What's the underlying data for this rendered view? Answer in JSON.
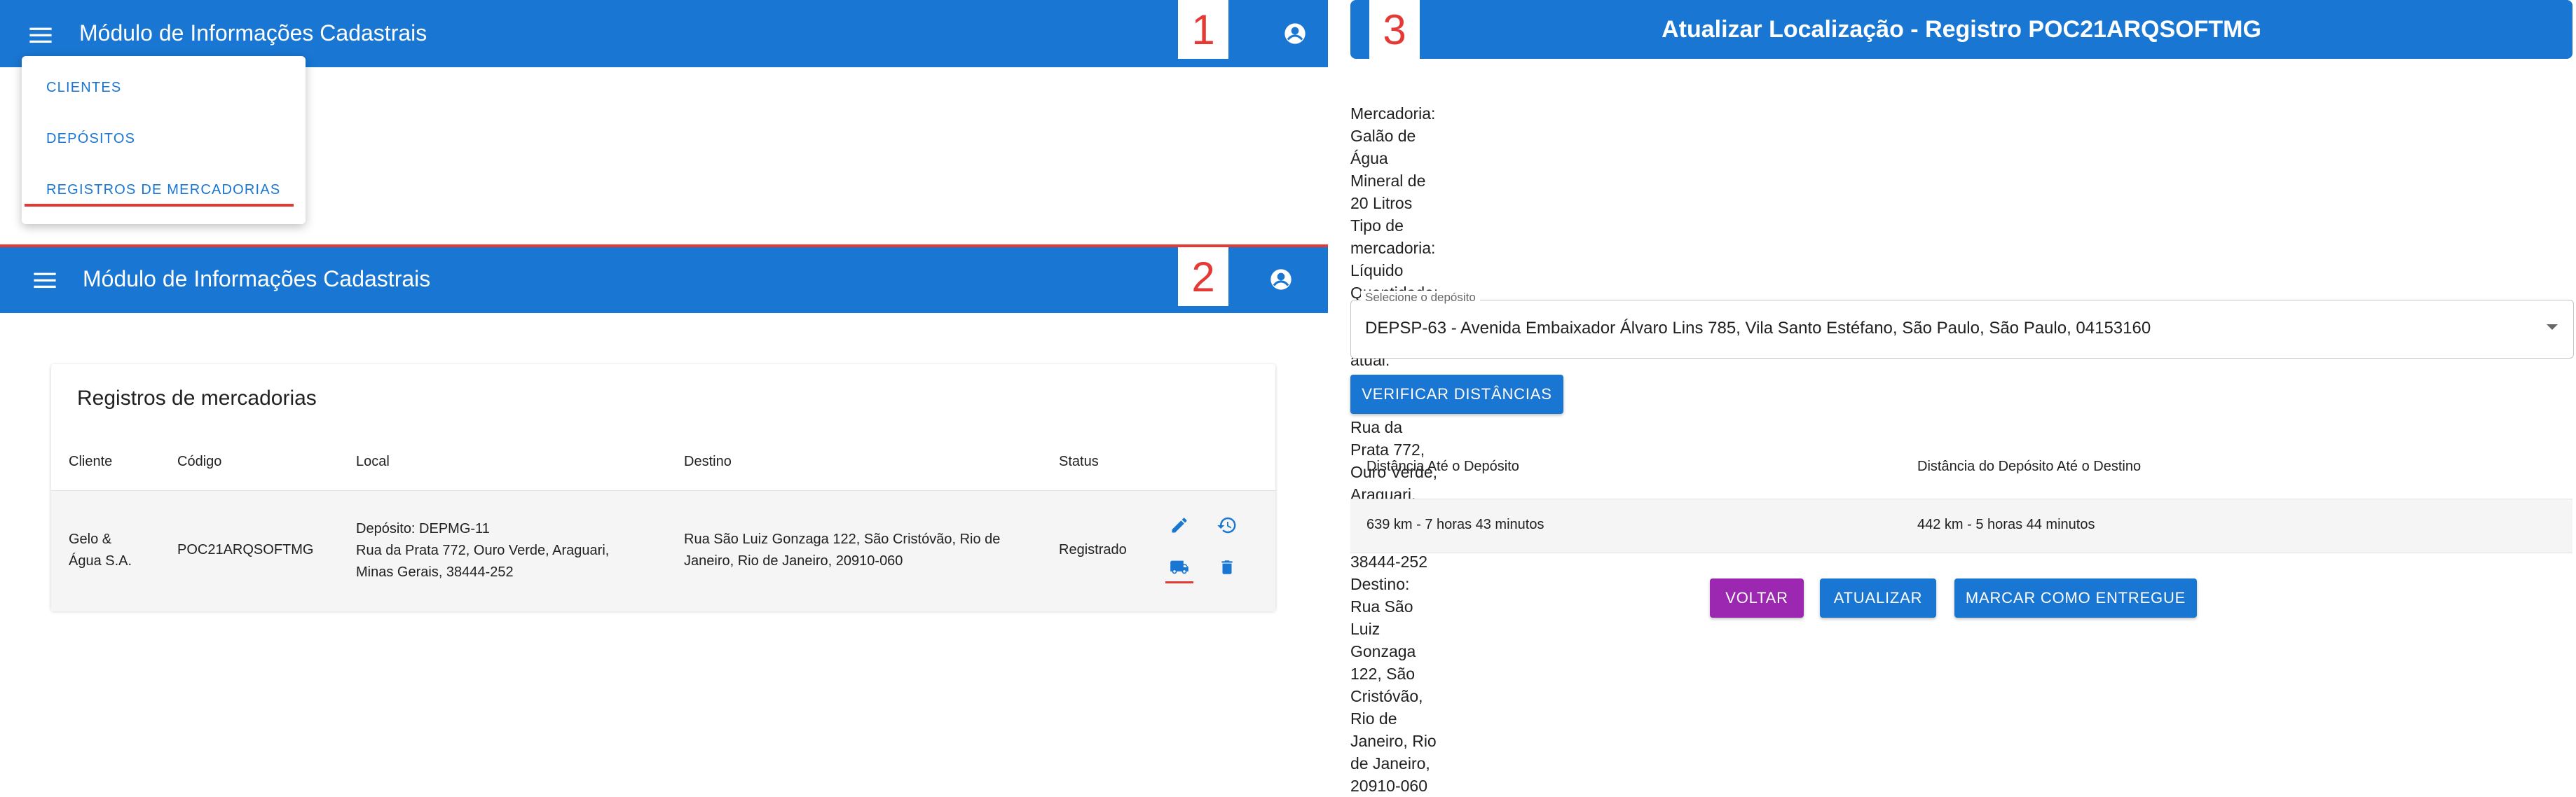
{
  "panel1": {
    "app_title": "Módulo de Informações Cadastrais",
    "badge": "1",
    "menu_items": [
      "CLIENTES",
      "DEPÓSITOS",
      "REGISTROS DE MERCADORIAS"
    ],
    "icons": {
      "menu": "hamburger-menu-icon",
      "account": "account-circle-icon"
    }
  },
  "panel2": {
    "app_title": "Módulo de Informações Cadastrais",
    "badge": "2",
    "card_title": "Registros de mercadorias",
    "columns": [
      "Cliente",
      "Código",
      "Local",
      "Destino",
      "Status"
    ],
    "rows": [
      {
        "cliente": "Gelo &\nÁgua S.A.",
        "codigo": "POC21ARQSOFTMG",
        "local": "Depósito: DEPMG-11\nRua da Prata 772, Ouro Verde, Araguari,\nMinas Gerais, 38444-252",
        "destino": "Rua São Luiz Gonzaga 122, São Cristóvão, Rio de\nJaneiro, Rio de Janeiro, 20910-060",
        "status": "Registrado"
      }
    ],
    "action_icons": [
      "edit-icon",
      "history-icon",
      "truck-icon",
      "delete-icon"
    ]
  },
  "panel3": {
    "badge": "3",
    "title": "Atualizar Localização - Registro POC21ARQSOFTMG",
    "info": "Mercadoria: Galão de Água Mineral de 20 Litros\nTipo de mercadoria: Líquido\nQuantidade: 10000\nLocalização atual:\nDepósito DEPMG-11\nRua da Prata 772, Ouro Verde, Araguari, Minas Gerais, 38444-252\nDestino: Rua São Luiz Gonzaga 122, São Cristóvão, Rio de Janeiro, Rio de Janeiro, 20910-060",
    "select_label": "Selecione o depósito",
    "select_value": "DEPSP-63 - Avenida Embaixador Álvaro Lins 785, Vila Santo Estéfano, São Paulo, São Paulo, 04153160",
    "verify_button": "VERIFICAR DISTÂNCIAS",
    "distance_headers": [
      "Distância Até o Depósito",
      "Distância do Depósito Até o Destino"
    ],
    "distance_values": [
      "639 km - 7 horas 43 minutos",
      "442 km - 5 horas 44 minutos"
    ],
    "buttons": {
      "back": "VOLTAR",
      "update": "ATUALIZAR",
      "deliver": "MARCAR COMO ENTREGUE"
    }
  },
  "colors": {
    "primary": "#1976d2",
    "accent_red": "#e53935",
    "back_button": "#9c27b0"
  }
}
